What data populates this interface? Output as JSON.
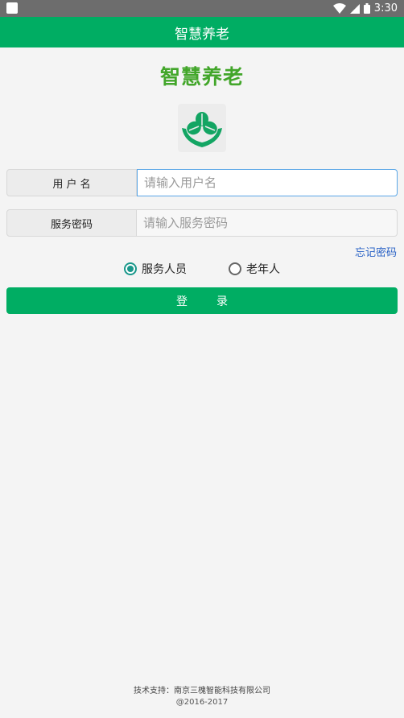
{
  "status_bar": {
    "time": "3:30"
  },
  "app_bar": {
    "title": "智慧养老"
  },
  "brand": {
    "title": "智慧养老",
    "logo_icon": "leaves-in-hands-icon",
    "logo_color": "#13a563"
  },
  "form": {
    "username": {
      "label": "用 户 名",
      "placeholder": "请输入用户名",
      "value": ""
    },
    "password": {
      "label": "服务密码",
      "placeholder": "请输入服务密码",
      "value": ""
    },
    "forgot_link": "忘记密码",
    "roles": [
      {
        "label": "服务人员",
        "checked": true
      },
      {
        "label": "老年人",
        "checked": false
      }
    ],
    "login_label": "登录"
  },
  "footer": {
    "support": "技术支持：南京三槐智能科技有限公司",
    "copyright": "@2016-2017"
  },
  "colors": {
    "primary": "#00ad63",
    "brand_text": "#42a62a",
    "link": "#2b63c6",
    "radio": "#19978a"
  }
}
